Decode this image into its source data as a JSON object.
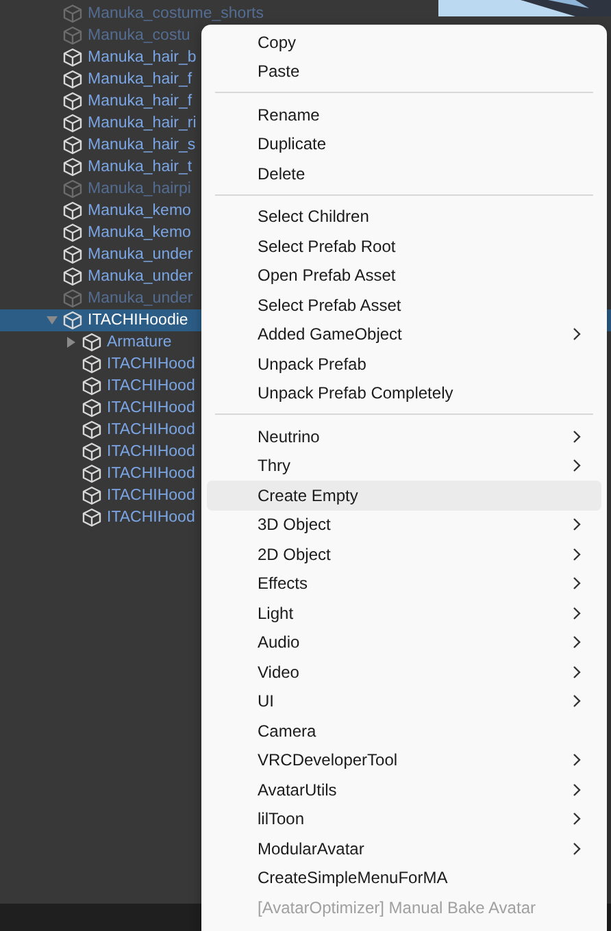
{
  "hierarchy": {
    "items": [
      {
        "name": "Manuka_costume_shorts",
        "active": false,
        "selected": false
      },
      {
        "name": "Manuka_costu",
        "active": false,
        "selected": false
      },
      {
        "name": "Manuka_hair_b",
        "active": true,
        "selected": false
      },
      {
        "name": "Manuka_hair_f",
        "active": true,
        "selected": false
      },
      {
        "name": "Manuka_hair_f",
        "active": true,
        "selected": false
      },
      {
        "name": "Manuka_hair_ri",
        "active": true,
        "selected": false
      },
      {
        "name": "Manuka_hair_s",
        "active": true,
        "selected": false
      },
      {
        "name": "Manuka_hair_t",
        "active": true,
        "selected": false
      },
      {
        "name": "Manuka_hairpi",
        "active": false,
        "selected": false
      },
      {
        "name": "Manuka_kemo",
        "active": true,
        "selected": false
      },
      {
        "name": "Manuka_kemo",
        "active": true,
        "selected": false
      },
      {
        "name": "Manuka_under",
        "active": true,
        "selected": false
      },
      {
        "name": "Manuka_under",
        "active": true,
        "selected": false
      },
      {
        "name": "Manuka_under",
        "active": false,
        "selected": false
      },
      {
        "name": "ITACHIHoodie",
        "active": true,
        "selected": true,
        "expanded": true,
        "children": [
          {
            "name": "Armature",
            "active": true,
            "selected": false,
            "expanded": false
          },
          {
            "name": "ITACHIHood",
            "active": true,
            "selected": false
          },
          {
            "name": "ITACHIHood",
            "active": true,
            "selected": false
          },
          {
            "name": "ITACHIHood",
            "active": true,
            "selected": false
          },
          {
            "name": "ITACHIHood",
            "active": true,
            "selected": false
          },
          {
            "name": "ITACHIHood",
            "active": true,
            "selected": false
          },
          {
            "name": "ITACHIHood",
            "active": true,
            "selected": false
          },
          {
            "name": "ITACHIHood",
            "active": true,
            "selected": false
          },
          {
            "name": "ITACHIHood",
            "active": true,
            "selected": false
          }
        ]
      }
    ]
  },
  "context_menu": {
    "items": [
      {
        "kind": "item",
        "label": "Copy"
      },
      {
        "kind": "item",
        "label": "Paste"
      },
      {
        "kind": "separator"
      },
      {
        "kind": "item",
        "label": "Rename"
      },
      {
        "kind": "item",
        "label": "Duplicate"
      },
      {
        "kind": "item",
        "label": "Delete"
      },
      {
        "kind": "separator"
      },
      {
        "kind": "item",
        "label": "Select Children"
      },
      {
        "kind": "item",
        "label": "Select Prefab Root"
      },
      {
        "kind": "item",
        "label": "Open Prefab Asset"
      },
      {
        "kind": "item",
        "label": "Select Prefab Asset"
      },
      {
        "kind": "item",
        "label": "Added GameObject",
        "submenu": true
      },
      {
        "kind": "item",
        "label": "Unpack Prefab"
      },
      {
        "kind": "item",
        "label": "Unpack Prefab Completely"
      },
      {
        "kind": "separator"
      },
      {
        "kind": "item",
        "label": "Neutrino",
        "submenu": true
      },
      {
        "kind": "item",
        "label": "Thry",
        "submenu": true
      },
      {
        "kind": "item",
        "label": "Create Empty",
        "hovered": true
      },
      {
        "kind": "item",
        "label": "3D Object",
        "submenu": true
      },
      {
        "kind": "item",
        "label": "2D Object",
        "submenu": true
      },
      {
        "kind": "item",
        "label": "Effects",
        "submenu": true
      },
      {
        "kind": "item",
        "label": "Light",
        "submenu": true
      },
      {
        "kind": "item",
        "label": "Audio",
        "submenu": true
      },
      {
        "kind": "item",
        "label": "Video",
        "submenu": true
      },
      {
        "kind": "item",
        "label": "UI",
        "submenu": true
      },
      {
        "kind": "item",
        "label": "Camera"
      },
      {
        "kind": "item",
        "label": "VRCDeveloperTool",
        "submenu": true
      },
      {
        "kind": "item",
        "label": "AvatarUtils",
        "submenu": true
      },
      {
        "kind": "item",
        "label": "lilToon",
        "submenu": true
      },
      {
        "kind": "item",
        "label": "ModularAvatar",
        "submenu": true
      },
      {
        "kind": "item",
        "label": "CreateSimpleMenuForMA"
      },
      {
        "kind": "item",
        "label": "[AvatarOptimizer] Manual Bake Avatar",
        "disabled": true
      }
    ]
  }
}
